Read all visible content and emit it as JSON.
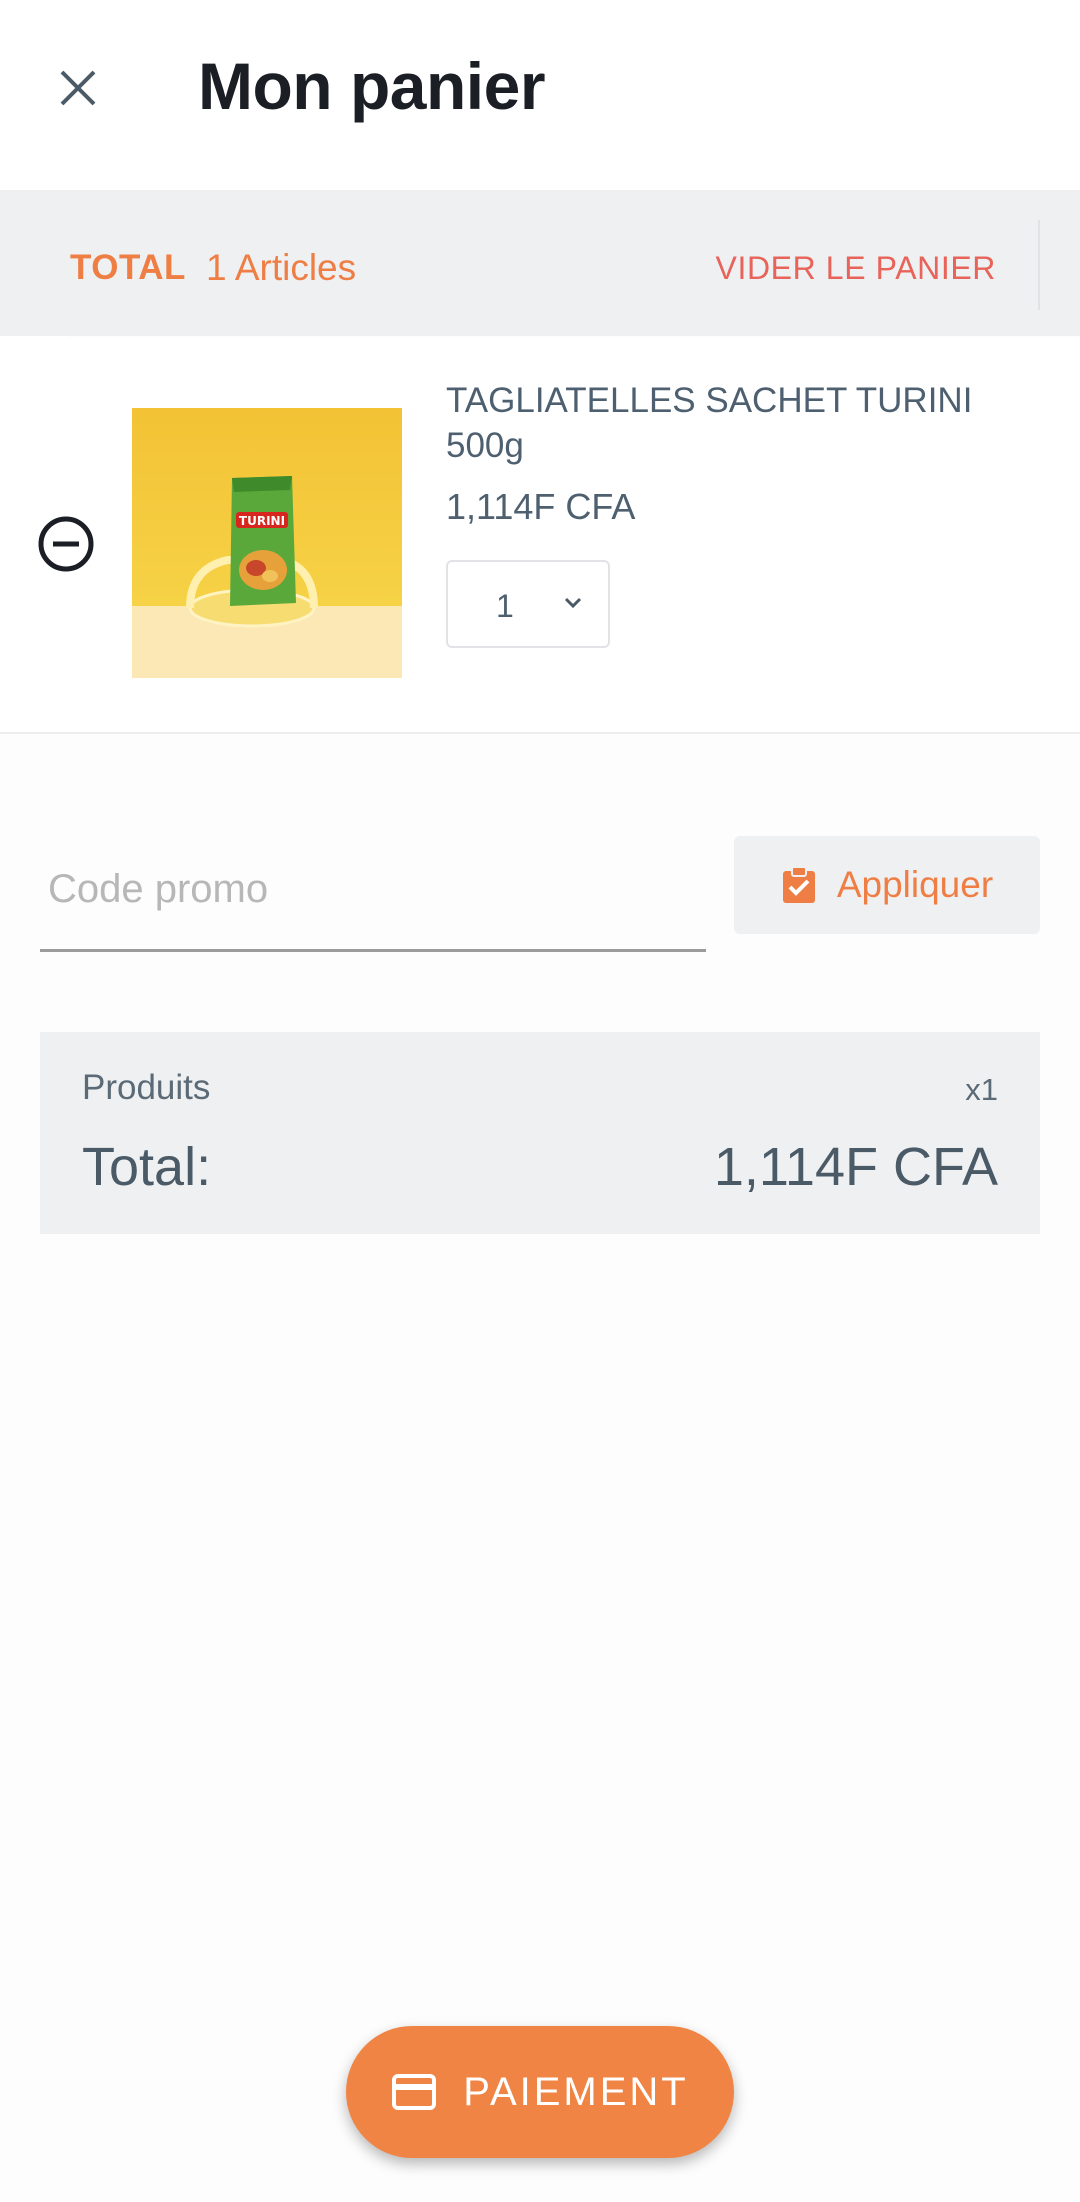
{
  "header": {
    "title": "Mon panier"
  },
  "summary_bar": {
    "total_label": "TOTAL",
    "articles_count": "1 Articles",
    "clear_label": "VIDER LE PANIER"
  },
  "cart": {
    "items": [
      {
        "name": "TAGLIATELLES SACHET TURINI 500g",
        "price": "1,114F CFA",
        "quantity": "1",
        "image_text": "TURINI"
      }
    ]
  },
  "promo": {
    "placeholder": "Code promo",
    "value": "",
    "apply_label": "Appliquer"
  },
  "order_summary": {
    "products_label": "Produits",
    "products_count": "x1",
    "total_label": "Total:",
    "total_value": "1,114F CFA"
  },
  "checkout": {
    "label": "PAIEMENT"
  },
  "colors": {
    "accent": "#ef7e45",
    "danger": "#e8635a",
    "panel": "#eff0f2",
    "text": "#4a5a66"
  }
}
